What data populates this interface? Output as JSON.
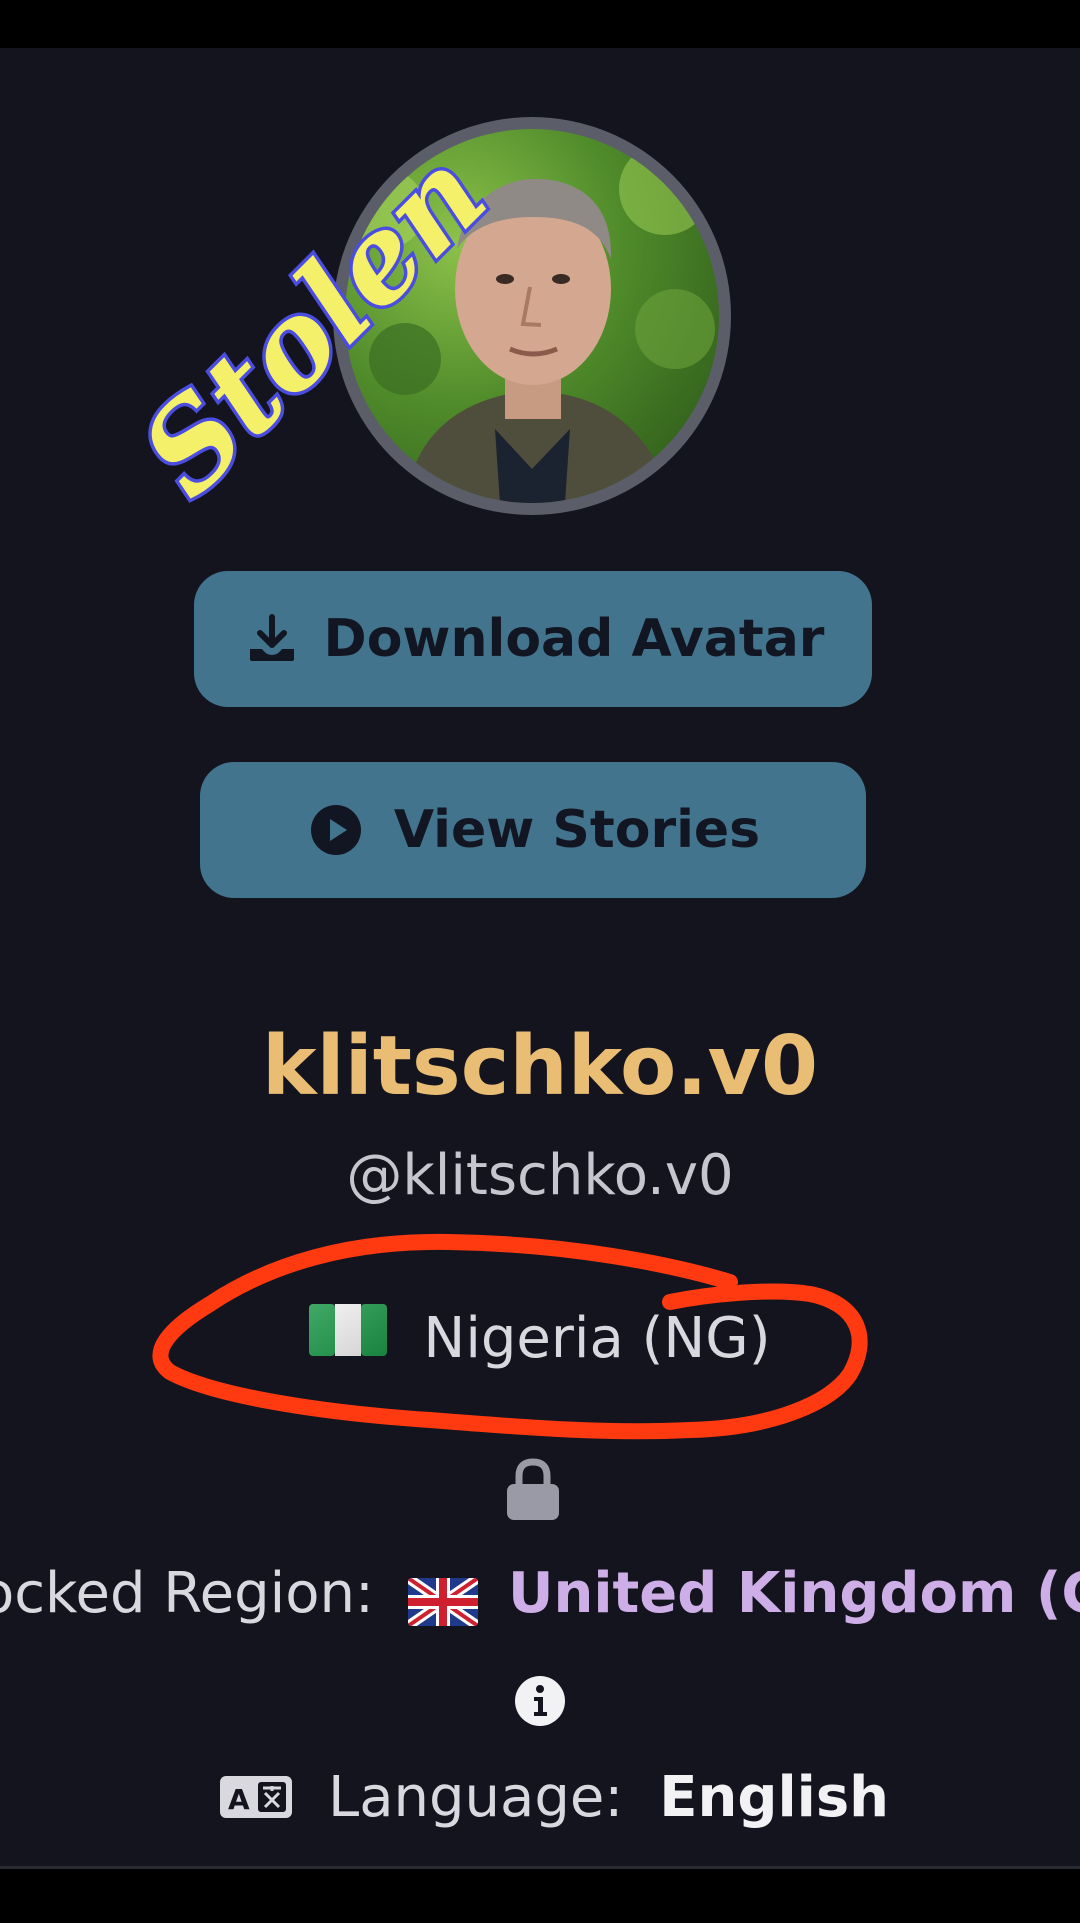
{
  "watermark": {
    "text": "Stolen"
  },
  "avatar": {
    "alt": "Profile photo"
  },
  "buttons": {
    "download_avatar": "Download Avatar",
    "view_stories": "View Stories"
  },
  "profile": {
    "display_name": "klitschko.v0",
    "handle": "@klitschko.v0",
    "country_flag": "🇳🇬",
    "country": "Nigeria (NG)",
    "locked_region_label": "ocked Region:",
    "locked_region_flag": "🇬🇧",
    "locked_region_value": "United Kingdom (GB",
    "language_label": "Language:",
    "language_value": "English"
  },
  "colors": {
    "background": "#14141f",
    "button": "#43748d",
    "display_name": "#e9bd74",
    "region_value": "#cdaee6",
    "annotation": "#ff3a10",
    "watermark_fill": "#f5f06a",
    "watermark_outline": "#4a4de0"
  },
  "icons": {
    "download": "download-icon",
    "play": "play-icon",
    "lock": "lock-icon",
    "info": "info-icon",
    "translate": "translate-icon"
  }
}
